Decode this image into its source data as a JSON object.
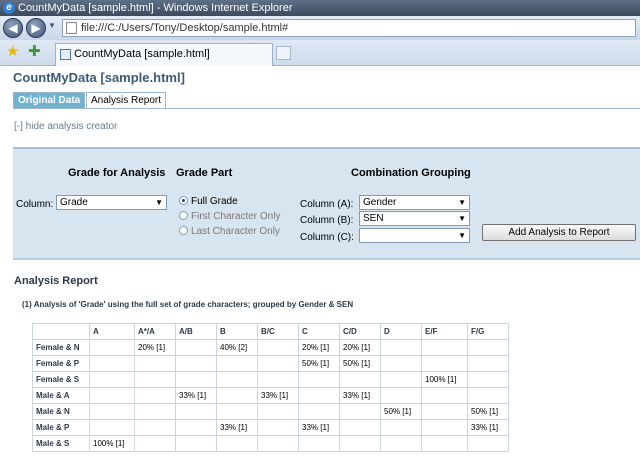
{
  "window": {
    "title": "CountMyData [sample.html] - Windows Internet Explorer",
    "address": "file:///C:/Users/Tony/Desktop/sample.html#",
    "tab_label": "CountMyData [sample.html]"
  },
  "app": {
    "title": "CountMyData [sample.html]",
    "tabs": [
      "Original Data",
      "Analysis Report"
    ],
    "hide_link": "[-] hide analysis creator"
  },
  "creator": {
    "grade_heading": "Grade for Analysis",
    "column_label": "Column:",
    "column_value": "Grade",
    "part_heading": "Grade Part",
    "part_options": [
      "Full Grade",
      "First Character Only",
      "Last Character Only"
    ],
    "combo_heading": "Combination Grouping",
    "combo_labels": [
      "Column (A):",
      "Column (B):",
      "Column (C):"
    ],
    "combo_values": [
      "Gender",
      "SEN",
      ""
    ],
    "add_button": "Add Analysis to Report"
  },
  "report": {
    "title": "Analysis Report",
    "description": "(1) Analysis of 'Grade' using the full set of grade characters; grouped by Gender & SEN",
    "columns": [
      "",
      "A",
      "A*/A",
      "A/B",
      "B",
      "B/C",
      "C",
      "C/D",
      "D",
      "E/F",
      "F/G"
    ],
    "rows": [
      [
        "Female & N",
        "",
        "20% [1]",
        "",
        "40% [2]",
        "",
        "20% [1]",
        "20% [1]",
        "",
        "",
        ""
      ],
      [
        "Female & P",
        "",
        "",
        "",
        "",
        "",
        "50% [1]",
        "50% [1]",
        "",
        "",
        ""
      ],
      [
        "Female & S",
        "",
        "",
        "",
        "",
        "",
        "",
        "",
        "",
        "100% [1]",
        ""
      ],
      [
        "Male & A",
        "",
        "",
        "33% [1]",
        "",
        "33% [1]",
        "",
        "33% [1]",
        "",
        "",
        ""
      ],
      [
        "Male & N",
        "",
        "",
        "",
        "",
        "",
        "",
        "",
        "50% [1]",
        "",
        "50% [1]"
      ],
      [
        "Male & P",
        "",
        "",
        "",
        "33% [1]",
        "",
        "33% [1]",
        "",
        "",
        "",
        "33% [1]"
      ],
      [
        "Male & S",
        "100% [1]",
        "",
        "",
        "",
        "",
        "",
        "",
        "",
        "",
        ""
      ]
    ]
  }
}
